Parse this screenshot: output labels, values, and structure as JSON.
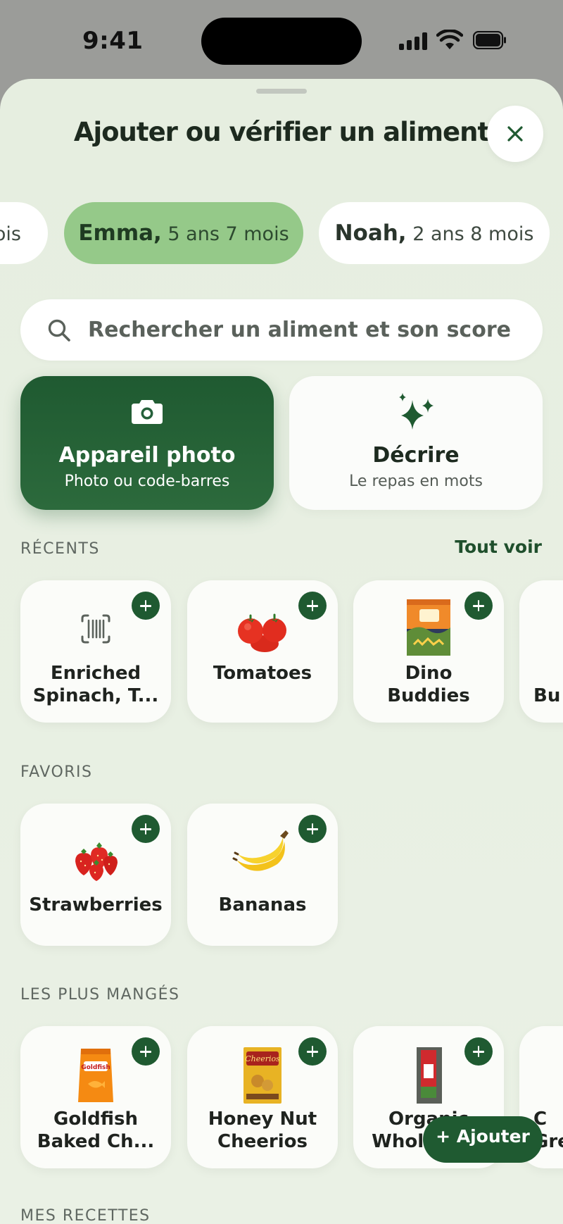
{
  "status_bar": {
    "time": "9:41"
  },
  "sheet": {
    "title": "Ajouter ou vérifier un aliment"
  },
  "children": [
    {
      "name": "",
      "age": "ois",
      "active": false
    },
    {
      "name": "Emma,",
      "age": "5 ans 7 mois",
      "active": true
    },
    {
      "name": "Noah,",
      "age": "2 ans 8 mois",
      "active": false
    }
  ],
  "search": {
    "placeholder": "Rechercher un aliment et son score"
  },
  "actions": {
    "camera": {
      "title": "Appareil photo",
      "subtitle": "Photo ou code-barres",
      "icon": "camera-icon"
    },
    "describe": {
      "title": "Décrire",
      "subtitle": "Le repas en mots",
      "icon": "sparkles-icon"
    }
  },
  "recents": {
    "label": "RÉCENTS",
    "see_all": "Tout voir",
    "items": [
      {
        "line1": "Enriched",
        "line2": "Spinach, T...",
        "icon": "barcode-icon"
      },
      {
        "line1": "Tomatoes",
        "line2": "",
        "icon": "tomato-image"
      },
      {
        "line1": "Dino",
        "line2": "Buddies",
        "icon": "package-image"
      },
      {
        "line1": "",
        "line2": "Bu",
        "icon": ""
      }
    ]
  },
  "favorites": {
    "label": "FAVORIS",
    "items": [
      {
        "line1": "Strawberries",
        "icon": "strawberry-image"
      },
      {
        "line1": "Bananas",
        "icon": "banana-image"
      }
    ]
  },
  "most_eaten": {
    "label": "LES PLUS MANGÉS",
    "items": [
      {
        "line1": "Goldfish",
        "line2": "Baked Ch...",
        "icon": "snack-bag-image"
      },
      {
        "line1": "Honey Nut",
        "line2": "Cheerios",
        "icon": "cereal-box-image"
      },
      {
        "line1": "Organic",
        "line2": "Whole Milk",
        "icon": "milk-image"
      },
      {
        "line1": "C",
        "line2": "Gre",
        "icon": ""
      }
    ]
  },
  "recipes": {
    "label": "MES RECETTES",
    "add_label": "+ Ajouter"
  },
  "colors": {
    "accent": "#1f5a31",
    "chip_active": "#95c989",
    "sheet_bg": "#e6eee0"
  }
}
